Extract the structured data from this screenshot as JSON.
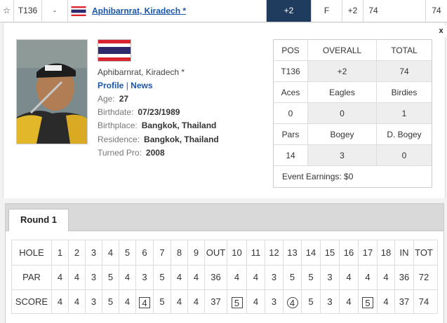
{
  "top_row": {
    "position": "T136",
    "movement": "-",
    "player_name": "Aphibarnrat, Kiradech *",
    "to_par": "+2",
    "thru": "F",
    "today": "+2",
    "total": "74",
    "last": "74"
  },
  "close_label": "x",
  "player": {
    "name": "Aphibarnrat, Kiradech *",
    "profile_link": "Profile",
    "separator": "|",
    "news_link": "News",
    "bio": [
      {
        "label": "Age:",
        "value": "27"
      },
      {
        "label": "Birthdate:",
        "value": "07/23/1989"
      },
      {
        "label": "Birthplace:",
        "value": "Bangkok, Thailand"
      },
      {
        "label": "Residence:",
        "value": "Bangkok, Thailand"
      },
      {
        "label": "Turned Pro:",
        "value": "2008"
      }
    ]
  },
  "stats": {
    "rows": [
      [
        "POS",
        "OVERALL",
        "TOTAL"
      ],
      [
        "T136",
        "+2",
        "74"
      ],
      [
        "Aces",
        "Eagles",
        "Birdies"
      ],
      [
        "0",
        "0",
        "1"
      ],
      [
        "Pars",
        "Bogey",
        "D. Bogey"
      ],
      [
        "14",
        "3",
        "0"
      ]
    ],
    "earnings": "Event Earnings: $0"
  },
  "round_tab": "Round 1",
  "scorecard": {
    "rows": [
      {
        "label": "HOLE",
        "cells": [
          "1",
          "2",
          "3",
          "4",
          "5",
          "6",
          "7",
          "8",
          "9",
          "OUT",
          "10",
          "11",
          "12",
          "13",
          "14",
          "15",
          "16",
          "17",
          "18",
          "IN",
          "TOT"
        ]
      },
      {
        "label": "PAR",
        "cells": [
          "4",
          "4",
          "3",
          "5",
          "4",
          "3",
          "5",
          "4",
          "4",
          "36",
          "4",
          "4",
          "3",
          "5",
          "5",
          "3",
          "4",
          "4",
          "4",
          "36",
          "72"
        ]
      },
      {
        "label": "SCORE",
        "cells": [
          "4",
          "4",
          "3",
          "5",
          "4",
          "4",
          "5",
          "4",
          "4",
          "37",
          "5",
          "4",
          "3",
          "4",
          "5",
          "3",
          "4",
          "5",
          "4",
          "37",
          "74"
        ]
      }
    ],
    "score_marks": [
      "",
      "",
      "",
      "",
      "",
      "bogey",
      "",
      "",
      "",
      "",
      "bogey",
      "",
      "",
      "birdie",
      "",
      "",
      "",
      "bogey",
      "",
      "",
      ""
    ]
  },
  "colors": {
    "accent_dark": "#1f3b5e",
    "link": "#1a56a8",
    "flag_red": "#d9232e",
    "flag_blue": "#2d2a6b"
  }
}
